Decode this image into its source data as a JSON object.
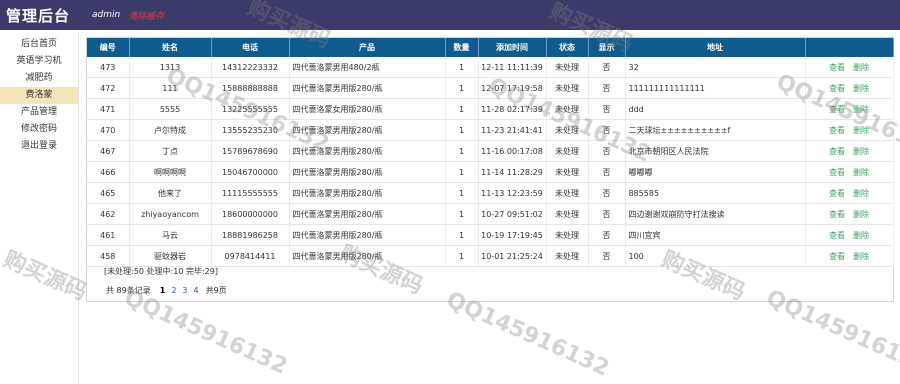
{
  "header": {
    "title": "管理后台",
    "user": "admin",
    "refresh": "清除缓存"
  },
  "sidebar": {
    "items": [
      {
        "label": "后台首页",
        "active": false
      },
      {
        "label": "英语学习机",
        "active": false
      },
      {
        "label": "减肥药",
        "active": false
      },
      {
        "label": "费洛蒙",
        "active": true
      },
      {
        "label": "产品管理",
        "active": false
      },
      {
        "label": "修改密码",
        "active": false
      },
      {
        "label": "退出登录",
        "active": false
      }
    ]
  },
  "table": {
    "columns": [
      "编号",
      "姓名",
      "电话",
      "产品",
      "数量",
      "添加时间",
      "状态",
      "显示",
      "地址",
      ""
    ],
    "rows": [
      {
        "id": "473",
        "name": "1313",
        "phone": "14312223332",
        "product": "四代蔷洛蒙男用480/2瓶",
        "qty": "1",
        "time": "12-11 11:11:39",
        "status": "未处理",
        "show": "否",
        "address": "32"
      },
      {
        "id": "472",
        "name": "111",
        "phone": "15888888888",
        "product": "四代蔷洛蒙男用版280/瓶",
        "qty": "1",
        "time": "12-07 17:19:58",
        "status": "未处理",
        "show": "否",
        "address": "111111111111111"
      },
      {
        "id": "471",
        "name": "5555",
        "phone": "13225555555",
        "product": "四代蔷洛蒙女用版280/瓶",
        "qty": "1",
        "time": "11-28 02:17:39",
        "status": "未处理",
        "show": "否",
        "address": "ddd"
      },
      {
        "id": "470",
        "name": "卢尔特成",
        "phone": "13555235230",
        "product": "四代蔷洛蒙男用版280/瓶",
        "qty": "1",
        "time": "11-23 21:41:41",
        "status": "未处理",
        "show": "否",
        "address": "二天球坛±±±±±±±±±±f"
      },
      {
        "id": "467",
        "name": "丁点",
        "phone": "15789678690",
        "product": "四代蔷洛蒙男用版280/瓶",
        "qty": "1",
        "time": "11-16 00:17:08",
        "status": "未处理",
        "show": "否",
        "address": "北京市朝阳区人民法院"
      },
      {
        "id": "466",
        "name": "啊啊啊啊",
        "phone": "15046700000",
        "product": "四代蔷洛蒙男用版280/瓶",
        "qty": "1",
        "time": "11-14 11:28:29",
        "status": "未处理",
        "show": "否",
        "address": "嘟嘟嘟"
      },
      {
        "id": "465",
        "name": "他来了",
        "phone": "11115555555",
        "product": "四代蔷洛蒙男用版280/瓶",
        "qty": "1",
        "time": "11-13 12:23:59",
        "status": "未处理",
        "show": "否",
        "address": "885585"
      },
      {
        "id": "462",
        "name": "zhiyaoyancom",
        "phone": "18600000000",
        "product": "四代蔷洛蒙男用版280/瓶",
        "qty": "1",
        "time": "10-27 09:51:02",
        "status": "未处理",
        "show": "否",
        "address": "四边谢谢双崩防守打法搜读"
      },
      {
        "id": "461",
        "name": "马云",
        "phone": "18881986258",
        "product": "四代蔷洛蒙男用版280/瓶",
        "qty": "1",
        "time": "10-19 17:19:45",
        "status": "未处理",
        "show": "否",
        "address": "四川宜宾"
      },
      {
        "id": "458",
        "name": "驱蚊器岩",
        "phone": "0978414411",
        "product": "四代蔷洛蒙男用版280/瓶",
        "qty": "1",
        "time": "10-01 21:25:24",
        "status": "未处理",
        "show": "否",
        "address": "100"
      }
    ],
    "ops": {
      "view": "查看",
      "delete": "删除"
    }
  },
  "summary": "[未处理:50   处理中:10   完毕:29]",
  "pager": {
    "total": "共 89条记录",
    "pages": [
      "1",
      "2",
      "3",
      "4"
    ],
    "current": "1",
    "page_count": "共9页"
  },
  "watermark": {
    "text": "购买源码",
    "qq": "QQ145916132"
  }
}
